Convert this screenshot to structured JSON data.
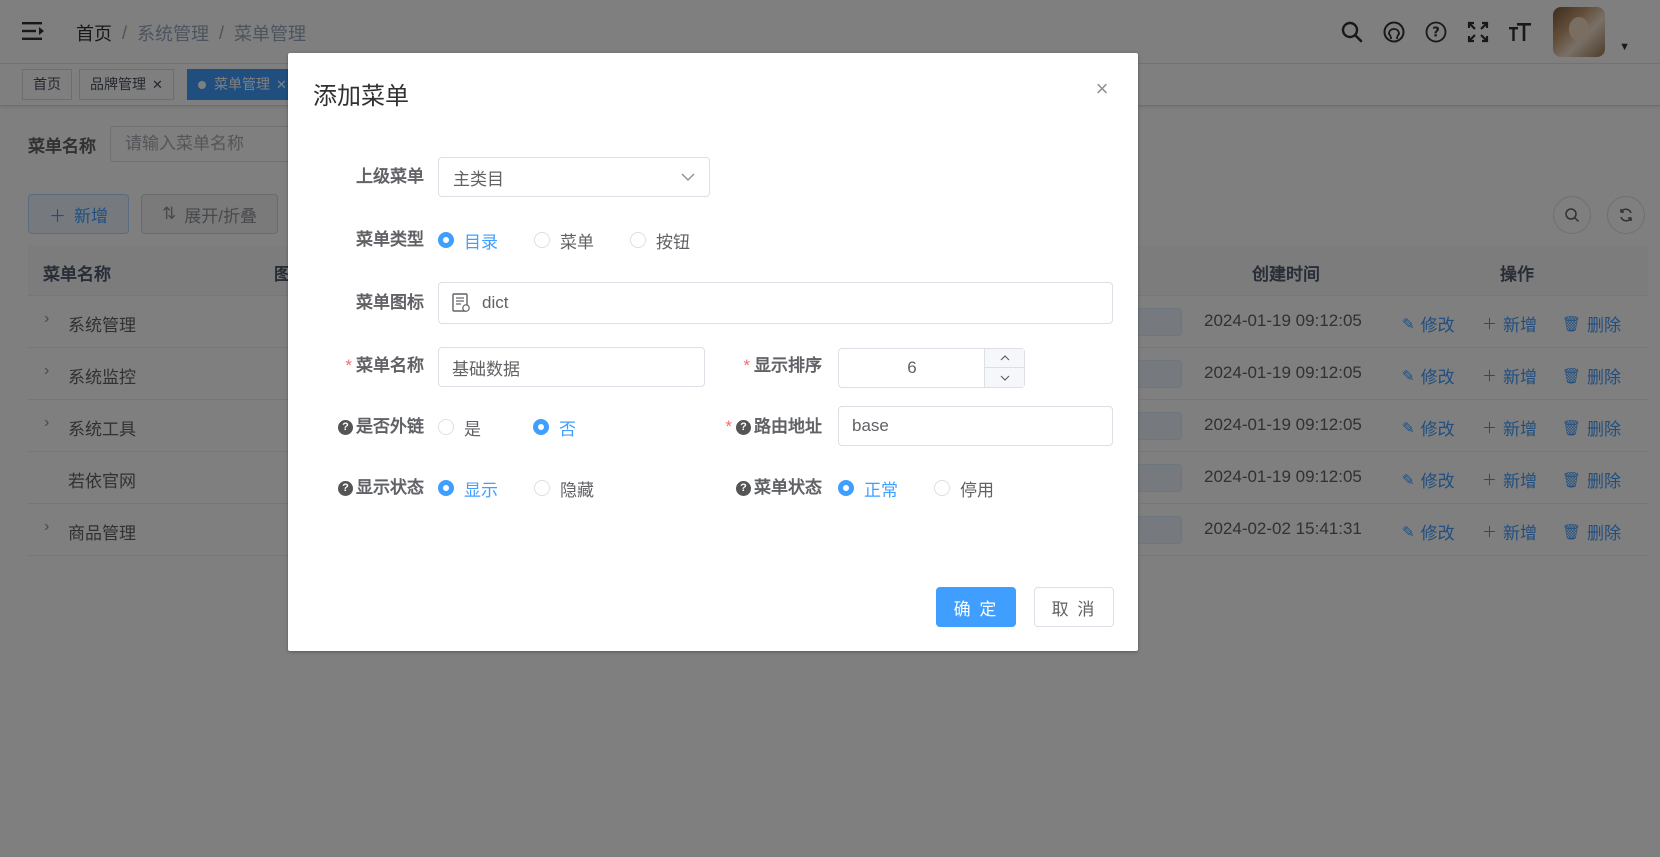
{
  "navbar": {
    "breadcrumb": [
      "首页",
      "系统管理",
      "菜单管理"
    ],
    "breadcrumb_sep": "/"
  },
  "tags": [
    {
      "label": "首页",
      "active": false,
      "closable": false
    },
    {
      "label": "品牌管理",
      "active": false,
      "closable": true
    },
    {
      "label": "菜单管理",
      "active": true,
      "closable": true
    }
  ],
  "search": {
    "label": "菜单名称",
    "placeholder": "请输入菜单名称"
  },
  "toolbar": {
    "add_label": "新增",
    "toggle_label": "展开/折叠"
  },
  "table": {
    "headers": {
      "name": "菜单名称",
      "icon": "图",
      "created": "创建时间",
      "ops": "操作"
    },
    "ops": {
      "edit": "修改",
      "add": "新增",
      "delete": "删除"
    },
    "rows": [
      {
        "name": "系统管理",
        "has_children": true,
        "created": "2024-01-19 09:12:05"
      },
      {
        "name": "系统监控",
        "has_children": true,
        "created": "2024-01-19 09:12:05"
      },
      {
        "name": "系统工具",
        "has_children": true,
        "created": "2024-01-19 09:12:05"
      },
      {
        "name": "若依官网",
        "has_children": false,
        "created": "2024-01-19 09:12:05"
      },
      {
        "name": "商品管理",
        "has_children": true,
        "created": "2024-02-02 15:41:31"
      }
    ]
  },
  "dialog": {
    "title": "添加菜单",
    "parent_menu": {
      "label": "上级菜单",
      "value": "主类目"
    },
    "menu_type": {
      "label": "菜单类型",
      "options": [
        "目录",
        "菜单",
        "按钮"
      ],
      "selected": 0
    },
    "menu_icon": {
      "label": "菜单图标",
      "value": "dict"
    },
    "menu_name": {
      "label": "菜单名称",
      "value": "基础数据"
    },
    "order": {
      "label": "显示排序",
      "value": "6"
    },
    "is_frame": {
      "label": "是否外链",
      "options": [
        "是",
        "否"
      ],
      "selected": 1
    },
    "path": {
      "label": "路由地址",
      "value": "base"
    },
    "visible": {
      "label": "显示状态",
      "options": [
        "显示",
        "隐藏"
      ],
      "selected": 0
    },
    "status": {
      "label": "菜单状态",
      "options": [
        "正常",
        "停用"
      ],
      "selected": 0
    },
    "confirm_label": "确 定",
    "cancel_label": "取 消"
  },
  "colors": {
    "primary": "#409eff",
    "required": "#f56c6c",
    "overlay": "rgba(0,0,0,0.5)"
  }
}
